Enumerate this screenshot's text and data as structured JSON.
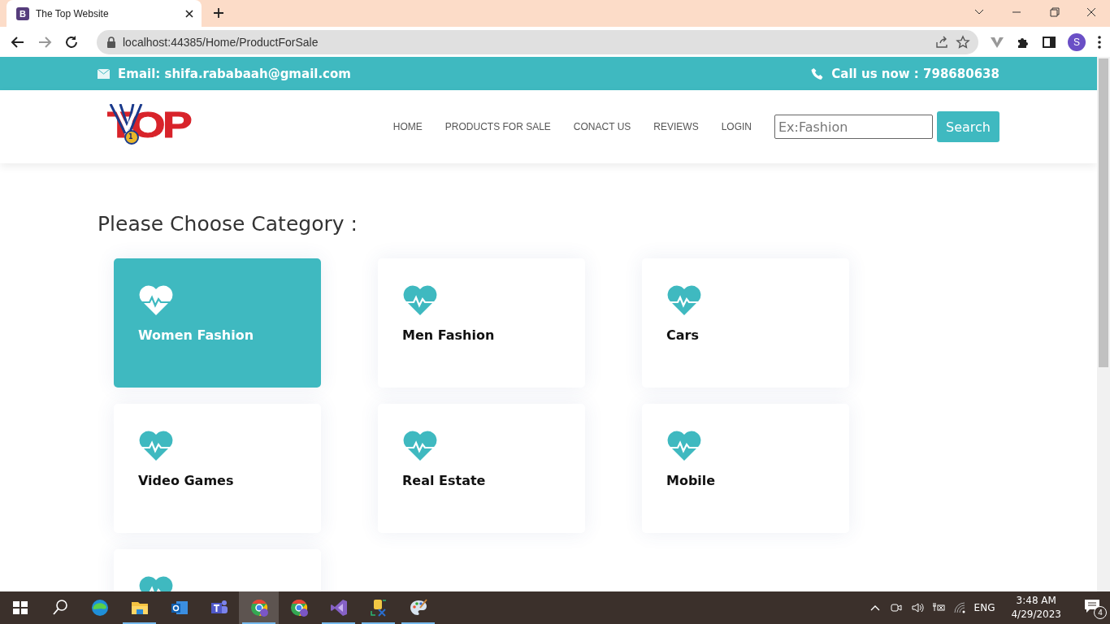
{
  "browser": {
    "tab_title": "The Top Website",
    "tab_favicon": "B",
    "url": "localhost:44385/Home/ProductForSale",
    "profile_initial": "S"
  },
  "topbar": {
    "email": "Email: shifa.rababaah@gmail.com",
    "phone": "Call us now : 798680638"
  },
  "header": {
    "logo_text": "TOP",
    "logo_medal": "1",
    "nav": [
      {
        "label": "HOME"
      },
      {
        "label": "PRODUCTS FOR SALE"
      },
      {
        "label": "CONACT US"
      },
      {
        "label": "REVIEWS"
      },
      {
        "label": "LOGIN"
      }
    ],
    "search": {
      "placeholder": "Ex:Fashion",
      "button": "Search"
    }
  },
  "heading": "Please Choose Category :",
  "categories": [
    {
      "name": "Women Fashion",
      "selected": true
    },
    {
      "name": "Men Fashion",
      "selected": false
    },
    {
      "name": "Cars",
      "selected": false
    },
    {
      "name": "Video Games",
      "selected": false
    },
    {
      "name": "Real Estate",
      "selected": false
    },
    {
      "name": "Mobile",
      "selected": false
    },
    {
      "selected": false
    }
  ],
  "taskbar": {
    "apps": [
      {
        "kind": "start",
        "running": false,
        "selected": false
      },
      {
        "kind": "search",
        "running": false,
        "selected": false
      },
      {
        "kind": "edge",
        "running": false,
        "selected": false
      },
      {
        "kind": "explorer",
        "running": true,
        "selected": false
      },
      {
        "kind": "outlook",
        "running": false,
        "selected": false
      },
      {
        "kind": "teams",
        "running": false,
        "selected": false
      },
      {
        "kind": "chrome",
        "running": true,
        "selected": true
      },
      {
        "kind": "chrome",
        "running": false,
        "selected": false
      },
      {
        "kind": "studio",
        "running": true,
        "selected": false
      },
      {
        "kind": "tool",
        "running": true,
        "selected": false
      },
      {
        "kind": "paint",
        "running": true,
        "selected": false
      }
    ],
    "tray": {
      "language": "ENG",
      "time": "3:48 AM",
      "date": "4/29/2023",
      "notifications": "4"
    }
  }
}
